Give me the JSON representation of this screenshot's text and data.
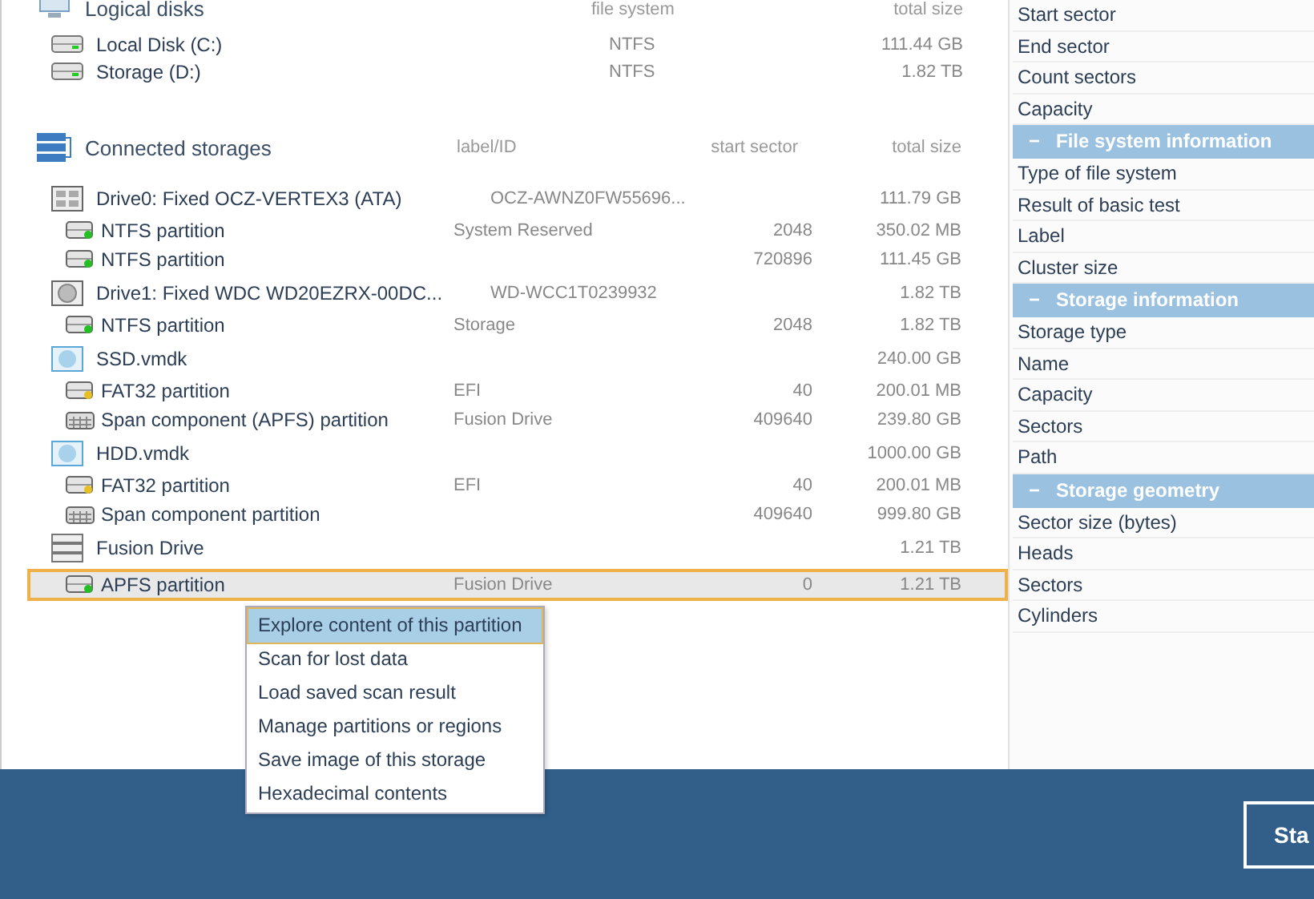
{
  "logical_disks": {
    "title": "Logical disks",
    "columns": [
      "file system",
      "total size"
    ],
    "rows": [
      {
        "name": "Local Disk (C:)",
        "file_system": "NTFS",
        "total_size": "111.44 GB"
      },
      {
        "name": "Storage (D:)",
        "file_system": "NTFS",
        "total_size": "1.82 TB"
      }
    ]
  },
  "connected_storages": {
    "title": "Connected storages",
    "columns": [
      "label/ID",
      "start sector",
      "total size"
    ],
    "rows": [
      {
        "kind": "ssd",
        "name": "Drive0: Fixed OCZ-VERTEX3 (ATA)",
        "label": "OCZ-AWNZ0FW55696...",
        "start_sector": "",
        "total_size": "111.79 GB",
        "selected": false
      },
      {
        "kind": "partition",
        "color": "#22c022",
        "name": "NTFS partition",
        "label": "System Reserved",
        "start_sector": "2048",
        "total_size": "350.02 MB",
        "selected": false
      },
      {
        "kind": "partition",
        "color": "#22c022",
        "name": "NTFS partition",
        "label": "",
        "start_sector": "720896",
        "total_size": "111.45 GB",
        "selected": false
      },
      {
        "kind": "hdd",
        "name": "Drive1: Fixed WDC WD20EZRX-00DC...",
        "label": "WD-WCC1T0239932",
        "start_sector": "",
        "total_size": "1.82 TB",
        "selected": false
      },
      {
        "kind": "partition",
        "color": "#22c022",
        "name": "NTFS partition",
        "label": "Storage",
        "start_sector": "2048",
        "total_size": "1.82 TB",
        "selected": false
      },
      {
        "kind": "vmdk",
        "name": "SSD.vmdk",
        "label": "",
        "start_sector": "",
        "total_size": "240.00 GB",
        "selected": false
      },
      {
        "kind": "partition",
        "color": "#e8c020",
        "name": "FAT32 partition",
        "label": "EFI",
        "start_sector": "40",
        "total_size": "200.01 MB",
        "selected": false
      },
      {
        "kind": "span",
        "name": "Span component (APFS) partition",
        "label": "Fusion Drive",
        "start_sector": "409640",
        "total_size": "239.80 GB",
        "selected": false
      },
      {
        "kind": "vmdk",
        "name": "HDD.vmdk",
        "label": "",
        "start_sector": "",
        "total_size": "1000.00 GB",
        "selected": false
      },
      {
        "kind": "partition",
        "color": "#e8c020",
        "name": "FAT32 partition",
        "label": "EFI",
        "start_sector": "40",
        "total_size": "200.01 MB",
        "selected": false
      },
      {
        "kind": "span",
        "name": "Span component partition",
        "label": "",
        "start_sector": "409640",
        "total_size": "999.80 GB",
        "selected": false
      },
      {
        "kind": "fusion",
        "name": "Fusion Drive",
        "label": "",
        "start_sector": "",
        "total_size": "1.21 TB",
        "selected": false
      },
      {
        "kind": "partition",
        "color": "#22c022",
        "name": "APFS partition",
        "label": "Fusion Drive",
        "start_sector": "0",
        "total_size": "1.21 TB",
        "selected": true
      }
    ]
  },
  "context_menu": [
    {
      "label": "Explore content of this partition",
      "selected": true
    },
    {
      "label": "Scan for lost data",
      "selected": false
    },
    {
      "label": "Load saved scan result",
      "selected": false
    },
    {
      "label": "Manage partitions or regions",
      "selected": false
    },
    {
      "label": "Save image of this storage",
      "selected": false
    },
    {
      "label": "Hexadecimal contents",
      "selected": false
    }
  ],
  "properties": [
    {
      "kind": "row",
      "label": "Start sector"
    },
    {
      "kind": "row",
      "label": "End sector"
    },
    {
      "kind": "row",
      "label": "Count sectors"
    },
    {
      "kind": "row",
      "label": "Capacity"
    },
    {
      "kind": "section",
      "toggle": "−",
      "label": "File system information"
    },
    {
      "kind": "row",
      "label": "Type of file system"
    },
    {
      "kind": "row",
      "label": "Result of basic test"
    },
    {
      "kind": "row",
      "label": "Label"
    },
    {
      "kind": "row",
      "label": "Cluster size"
    },
    {
      "kind": "section",
      "toggle": "−",
      "label": "Storage information"
    },
    {
      "kind": "row",
      "label": "Storage type"
    },
    {
      "kind": "row",
      "label": "Name"
    },
    {
      "kind": "row",
      "label": "Capacity"
    },
    {
      "kind": "row",
      "label": "Sectors"
    },
    {
      "kind": "row",
      "label": "Path"
    },
    {
      "kind": "section",
      "toggle": "−",
      "label": "Storage geometry"
    },
    {
      "kind": "row",
      "label": "Sector size (bytes)"
    },
    {
      "kind": "row",
      "label": "Heads"
    },
    {
      "kind": "row",
      "label": "Sectors"
    },
    {
      "kind": "row",
      "label": "Cylinders"
    }
  ],
  "footer": {
    "button": "Sta"
  }
}
